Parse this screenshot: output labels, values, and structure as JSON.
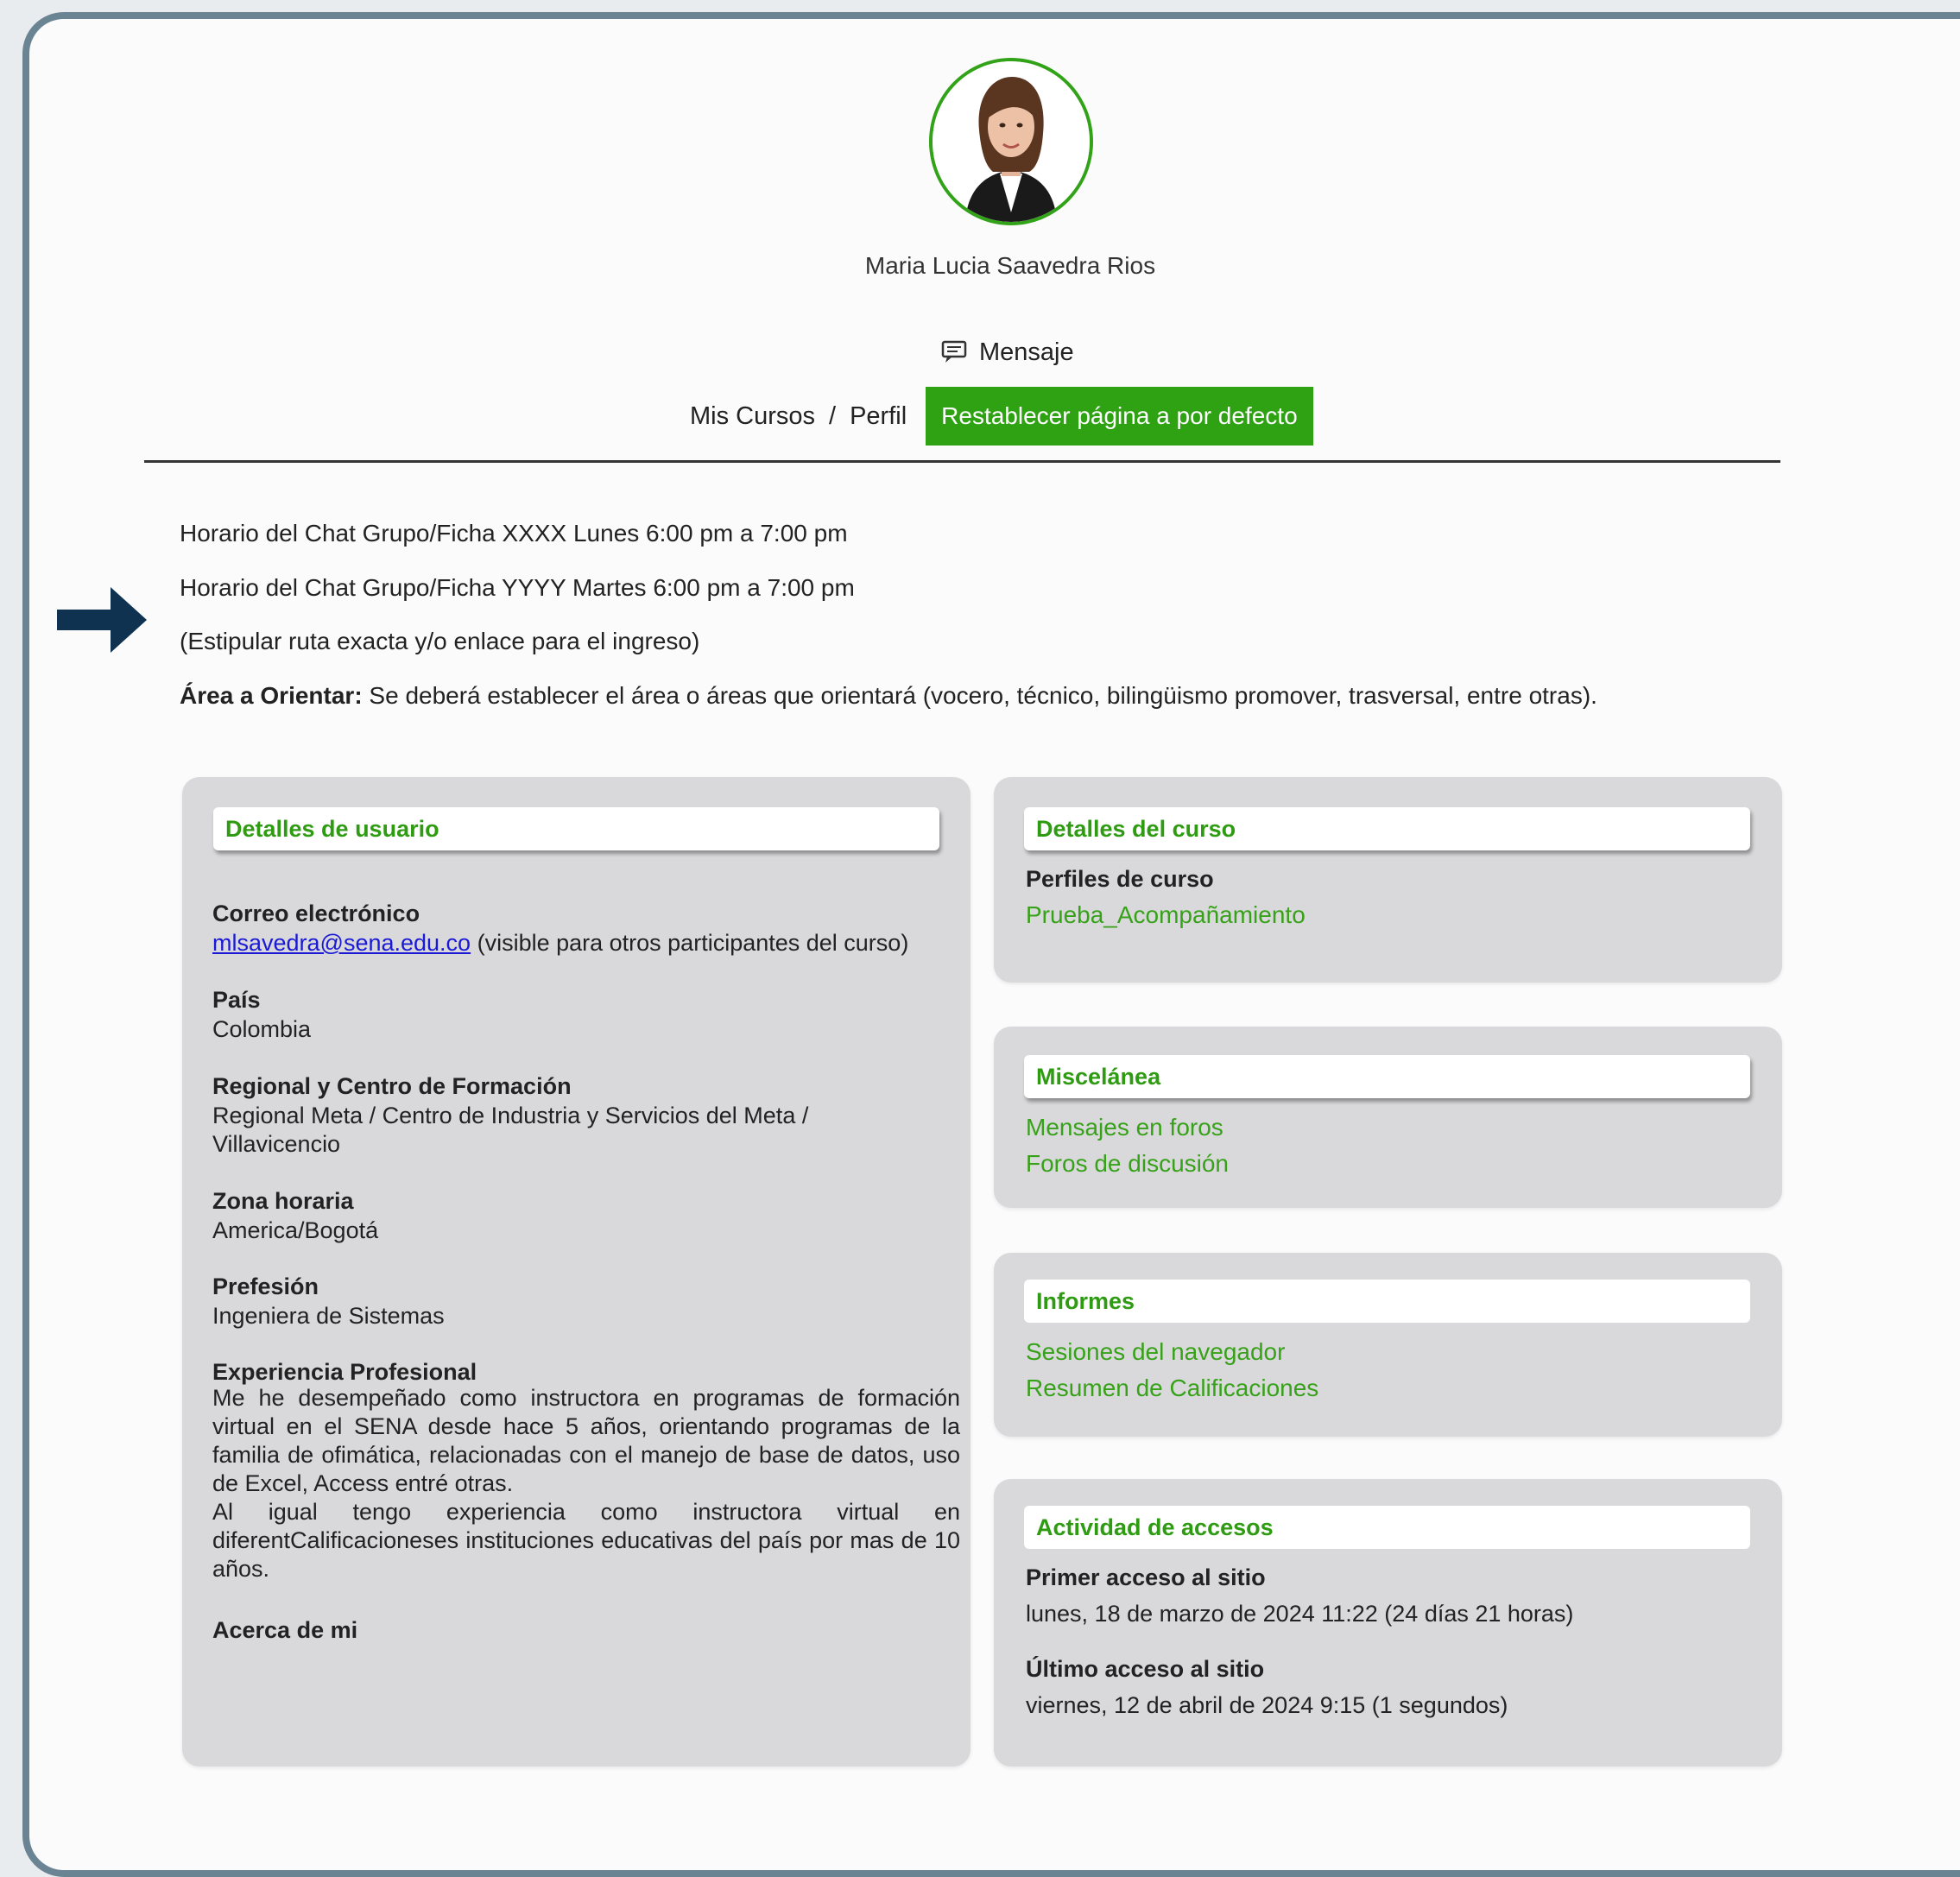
{
  "profile": {
    "name": "Maria Lucia Saavedra Rios",
    "message_label": "Mensaje"
  },
  "breadcrumb": {
    "items": [
      "Mis Cursos",
      "Perfil"
    ],
    "separator": "/"
  },
  "reset_button": "Restablecer página a por defecto",
  "info": {
    "line1": "Horario del Chat Grupo/Ficha XXXX Lunes 6:00 pm a 7:00 pm",
    "line2": "Horario del Chat Grupo/Ficha YYYY Martes 6:00 pm a 7:00 pm",
    "line3": "(Estipular ruta exacta y/o enlace para el ingreso)",
    "area_label": "Área a Orientar:",
    "area_text": " Se deberá establecer el área o áreas que orientará (vocero, técnico, bilingüismo promover, trasversal, entre otras)."
  },
  "user_details": {
    "title": "Detalles de usuario",
    "email_label": "Correo electrónico",
    "email": "mlsavedra@sena.edu.co",
    "email_note": " (visible para otros participantes del curso)",
    "country_label": "País",
    "country": "Colombia",
    "regional_label": "Regional y Centro de Formación",
    "regional_line1": "Regional Meta / Centro de Industria y Servicios del Meta /",
    "regional_line2": "Villavicencio",
    "timezone_label": "Zona horaria",
    "timezone": "America/Bogotá",
    "profession_label": "Prefesión",
    "profession": "Ingeniera de Sistemas",
    "experience_label": "Experiencia Profesional",
    "experience_p1": "Me he desempeñado como instructora en programas de formación virtual en el SENA desde hace 5 años,  orientando programas de la familia de ofimática, relacionadas con el manejo de base de datos, uso de Excel, Access entré otras.",
    "experience_p2": "Al igual tengo experiencia como instructora virtual en diferentCalificacioneses instituciones educativas del país por mas de 10 años.",
    "about_label": "Acerca de mi"
  },
  "course_details": {
    "title": "Detalles del curso",
    "profiles_label": "Perfiles de curso",
    "profile_link": "Prueba_Acompañamiento"
  },
  "misc": {
    "title": "Miscelánea",
    "links": [
      "Mensajes en foros",
      "Foros de discusión"
    ]
  },
  "reports": {
    "title": "Informes",
    "links": [
      "Sesiones del navegador",
      "Resumen de Calificaciones"
    ]
  },
  "access": {
    "title": "Actividad de accesos",
    "first_label": "Primer acceso al sitio",
    "first_value": "lunes, 18 de marzo de 2024 11:22  (24 días 21 horas)",
    "last_label": "Último acceso al sitio",
    "last_value": "viernes, 12 de abril de 2024 9:15  (1 segundos)"
  },
  "colors": {
    "accent_green": "#2fa214",
    "arrow_navy": "#0f3250",
    "panel_gray": "#d9d9db"
  },
  "icons": [
    "message-icon",
    "arrow-right-icon",
    "avatar-photo"
  ]
}
